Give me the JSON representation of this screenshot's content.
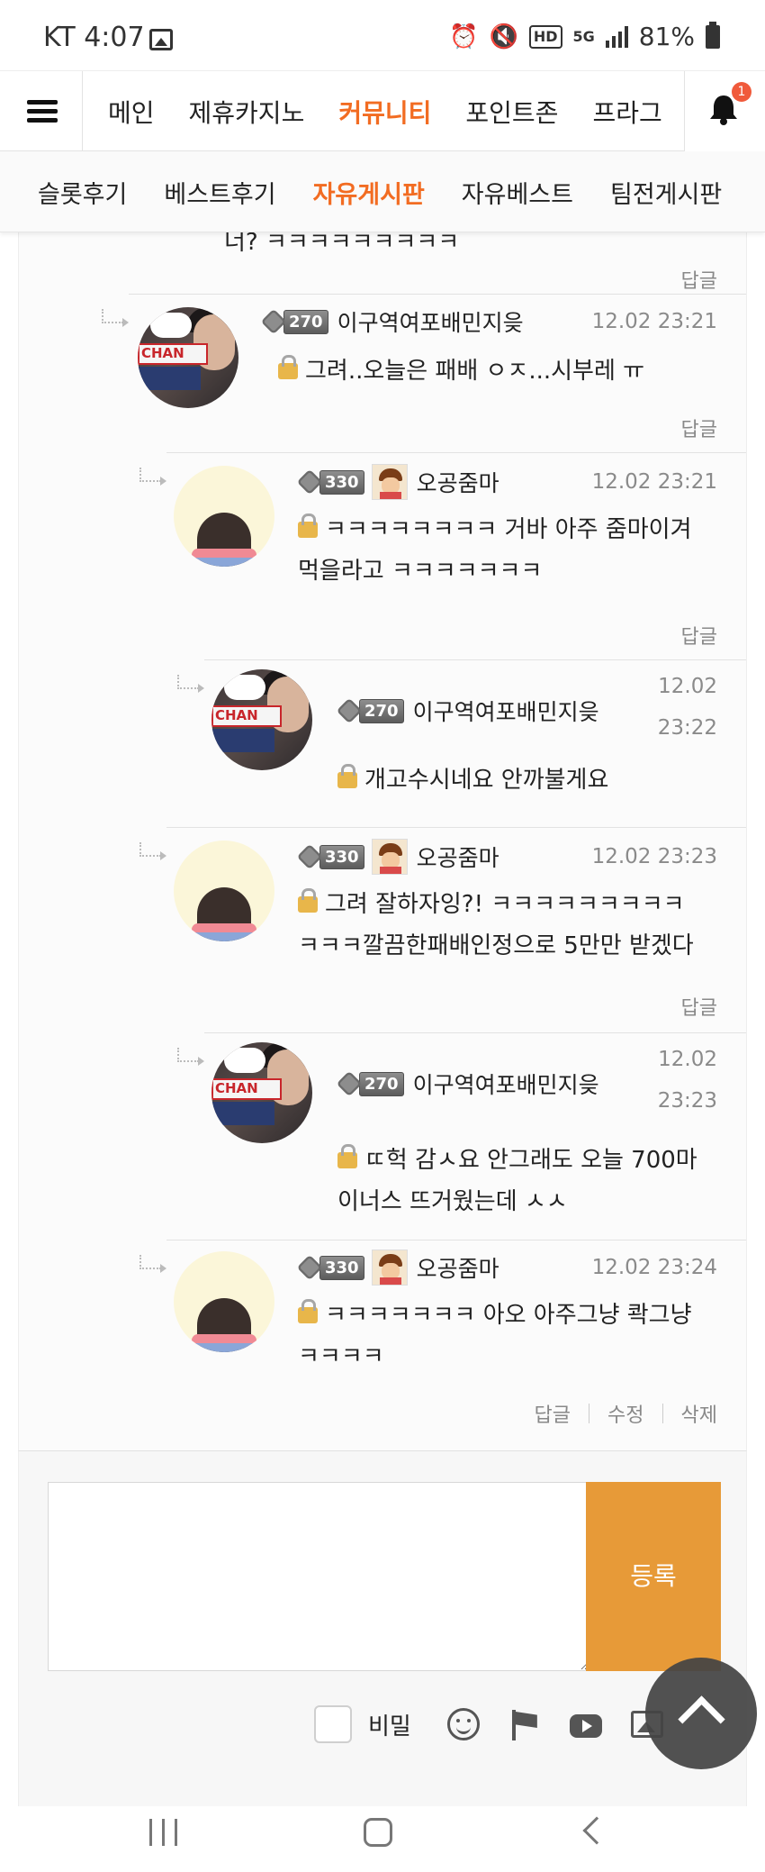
{
  "status_bar": {
    "carrier_time": "KT 4:07",
    "battery": "81%",
    "hd_label": "HD",
    "network": "5G"
  },
  "main_nav": {
    "items": [
      "메인",
      "제휴카지노",
      "커뮤니티",
      "포인트존",
      "프라그"
    ],
    "active": "커뮤니티",
    "notification_count": "1"
  },
  "sub_nav": {
    "items": [
      "슬롯후기",
      "베스트후기",
      "자유게시판",
      "자유베스트",
      "팀전게시판"
    ],
    "active": "자유게시판"
  },
  "top_partial": {
    "text": "너? ㅋㅋㅋㅋㅋㅋㅋㅋㅋ",
    "reply_label": "답글"
  },
  "comments": [
    {
      "level": "270",
      "nickname": "이구역여포배민지읒",
      "date": "12.02 23:21",
      "text_lines": [
        "그려..오늘은 패배 ㅇㅈ...시부레 ㅠ"
      ],
      "actions": [
        "답글"
      ]
    },
    {
      "level": "330",
      "nickname": "오공줌마",
      "date": "12.02 23:21",
      "text_lines": [
        "ㅋㅋㅋㅋㅋㅋㅋㅋ 거바 아주 줌마이겨",
        "먹을라고 ㅋㅋㅋㅋㅋㅋㅋ"
      ],
      "actions": [
        "답글"
      ]
    },
    {
      "level": "270",
      "nickname": "이구역여포배민지읒",
      "date_line1": "12.02",
      "date_line2": "23:22",
      "text_lines": [
        "개고수시네요 안까불게요"
      ],
      "actions": []
    },
    {
      "level": "330",
      "nickname": "오공줌마",
      "date": "12.02 23:23",
      "text_lines": [
        "그려 잘하자잉?! ㅋㅋㅋㅋㅋㅋㅋㅋㅋ",
        "ㅋㅋㅋ깔끔한패배인정으로 5만만 받겠다"
      ],
      "actions": [
        "답글"
      ]
    },
    {
      "level": "270",
      "nickname": "이구역여포배민지읒",
      "date_line1": "12.02",
      "date_line2": "23:23",
      "text_lines": [
        "ㄸ헉 감ㅅ요 안그래도 오늘 700마",
        "이너스 뜨거웠는데 ㅅㅅ"
      ],
      "actions": []
    },
    {
      "level": "330",
      "nickname": "오공줌마",
      "date": "12.02 23:24",
      "text_lines": [
        "ㅋㅋㅋㅋㅋㅋㅋ 아오 아주그냥 콱그냥",
        "ㅋㅋㅋㅋ"
      ],
      "actions": [
        "답글",
        "수정",
        "삭제"
      ]
    }
  ],
  "composer": {
    "input_value": "",
    "submit_label": "등록",
    "secret_label": "비밀"
  },
  "icons": {
    "menu": "hamburger-icon",
    "bell": "bell-icon",
    "lock": "lock-icon",
    "emoji": "emoji-icon",
    "flag": "flag-icon",
    "youtube": "youtube-icon",
    "image": "image-icon",
    "scroll_top": "chevron-up-icon"
  },
  "colors": {
    "accent": "#f26c22",
    "submit": "#e79a38",
    "badge": "#f05a3b"
  }
}
